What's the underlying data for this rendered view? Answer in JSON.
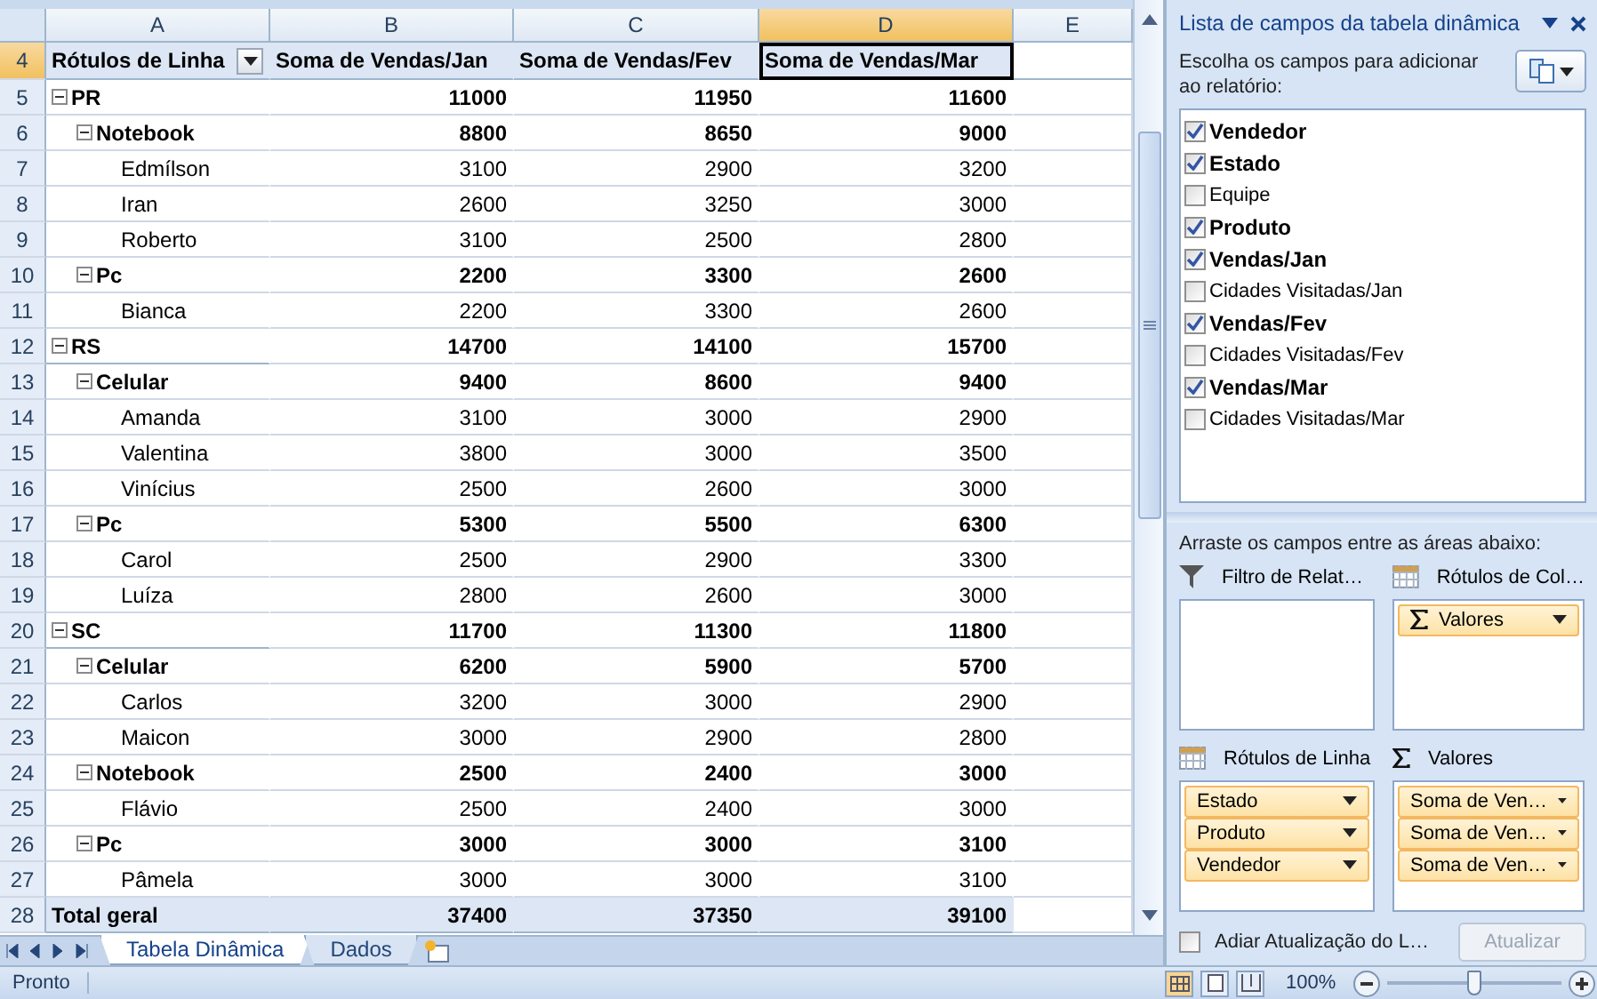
{
  "sheet": {
    "columns": [
      {
        "label": "A",
        "selected": false
      },
      {
        "label": "B",
        "selected": false
      },
      {
        "label": "C",
        "selected": false
      },
      {
        "label": "D",
        "selected": true
      },
      {
        "label": "E",
        "selected": false
      }
    ],
    "header_row": {
      "number": "4",
      "cells": [
        "Rótulos de Linha",
        "Soma de Vendas/Jan",
        "Soma de Vendas/Fev",
        "Soma de Vendas/Mar"
      ]
    },
    "rows": [
      {
        "number": "5",
        "label": "PR",
        "values": [
          "11000",
          "11950",
          "11600"
        ],
        "expanded": true,
        "children": [
          {
            "number": "6",
            "label": "Notebook",
            "values": [
              "8800",
              "8650",
              "9000"
            ],
            "expanded": true,
            "children": [
              {
                "number": "7",
                "label": "Edmílson",
                "values": [
                  "3100",
                  "2900",
                  "3200"
                ]
              },
              {
                "number": "8",
                "label": "Iran",
                "values": [
                  "2600",
                  "3250",
                  "3000"
                ]
              },
              {
                "number": "9",
                "label": "Roberto",
                "values": [
                  "3100",
                  "2500",
                  "2800"
                ]
              }
            ]
          },
          {
            "number": "10",
            "label": "Pc",
            "values": [
              "2200",
              "3300",
              "2600"
            ],
            "expanded": true,
            "children": [
              {
                "number": "11",
                "label": "Bianca",
                "values": [
                  "2200",
                  "3300",
                  "2600"
                ]
              }
            ]
          }
        ]
      },
      {
        "number": "12",
        "label": "RS",
        "values": [
          "14700",
          "14100",
          "15700"
        ],
        "expanded": true,
        "children": [
          {
            "number": "13",
            "label": "Celular",
            "values": [
              "9400",
              "8600",
              "9400"
            ],
            "expanded": true,
            "children": [
              {
                "number": "14",
                "label": "Amanda",
                "values": [
                  "3100",
                  "3000",
                  "2900"
                ]
              },
              {
                "number": "15",
                "label": "Valentina",
                "values": [
                  "3800",
                  "3000",
                  "3500"
                ]
              },
              {
                "number": "16",
                "label": "Vinícius",
                "values": [
                  "2500",
                  "2600",
                  "3000"
                ]
              }
            ]
          },
          {
            "number": "17",
            "label": "Pc",
            "values": [
              "5300",
              "5500",
              "6300"
            ],
            "expanded": true,
            "children": [
              {
                "number": "18",
                "label": "Carol",
                "values": [
                  "2500",
                  "2900",
                  "3300"
                ]
              },
              {
                "number": "19",
                "label": "Luíza",
                "values": [
                  "2800",
                  "2600",
                  "3000"
                ]
              }
            ]
          }
        ]
      },
      {
        "number": "20",
        "label": "SC",
        "values": [
          "11700",
          "11300",
          "11800"
        ],
        "expanded": true,
        "children": [
          {
            "number": "21",
            "label": "Celular",
            "values": [
              "6200",
              "5900",
              "5700"
            ],
            "expanded": true,
            "children": [
              {
                "number": "22",
                "label": "Carlos",
                "values": [
                  "3200",
                  "3000",
                  "2900"
                ]
              },
              {
                "number": "23",
                "label": "Maicon",
                "values": [
                  "3000",
                  "2900",
                  "2800"
                ]
              }
            ]
          },
          {
            "number": "24",
            "label": "Notebook",
            "values": [
              "2500",
              "2400",
              "3000"
            ],
            "expanded": true,
            "children": [
              {
                "number": "25",
                "label": "Flávio",
                "values": [
                  "2500",
                  "2400",
                  "3000"
                ]
              }
            ]
          },
          {
            "number": "26",
            "label": "Pc",
            "values": [
              "3000",
              "3000",
              "3100"
            ],
            "expanded": true,
            "children": [
              {
                "number": "27",
                "label": "Pâmela",
                "values": [
                  "3000",
                  "3000",
                  "3100"
                ]
              }
            ]
          }
        ]
      }
    ],
    "total_row": {
      "number": "28",
      "label": "Total geral",
      "values": [
        "37400",
        "37350",
        "39100"
      ]
    }
  },
  "sheet_tabs": [
    {
      "label": "Tabela Dinâmica",
      "selected": true
    },
    {
      "label": "Dados",
      "selected": false
    }
  ],
  "status_bar": {
    "text": "Pronto",
    "zoom": "100%",
    "zoom_level": {
      "level": 0.5
    }
  },
  "field_list": {
    "title": "Lista de campos da tabela dinâmica",
    "instruction": "Escolha os campos para adicionar ao relatório:",
    "fields": [
      {
        "label": "Vendedor",
        "checked": true
      },
      {
        "label": "Estado",
        "checked": true
      },
      {
        "label": "Equipe",
        "checked": false
      },
      {
        "label": "Produto",
        "checked": true
      },
      {
        "label": "Vendas/Jan",
        "checked": true
      },
      {
        "label": "Cidades Visitadas/Jan",
        "checked": false
      },
      {
        "label": "Vendas/Fev",
        "checked": true
      },
      {
        "label": "Cidades Visitadas/Fev",
        "checked": false
      },
      {
        "label": "Vendas/Mar",
        "checked": true
      },
      {
        "label": "Cidades Visitadas/Mar",
        "checked": false
      }
    ],
    "areas_instruction": "Arraste os campos entre as áreas abaixo:",
    "areas": [
      {
        "kind": "filter",
        "title": "Filtro de Relat…"
      },
      {
        "kind": "columns",
        "title": "Rótulos de Col…",
        "items": [
          {
            "label": "Valores",
            "sigma": true
          }
        ]
      },
      {
        "kind": "rows",
        "title": "Rótulos de Linha",
        "items": [
          {
            "label": "Estado",
            "sigma": false
          },
          {
            "label": "Produto",
            "sigma": false
          },
          {
            "label": "Vendedor",
            "sigma": false
          }
        ]
      },
      {
        "kind": "values",
        "title": "Valores",
        "items": [
          {
            "label": "Soma de Ven…",
            "sigma": false
          },
          {
            "label": "Soma de Ven…",
            "sigma": false
          },
          {
            "label": "Soma de Ven…",
            "sigma": false
          }
        ]
      }
    ],
    "defer": {
      "label": "Adiar Atualização do L…",
      "checked": false
    },
    "update_button": {
      "label": "Atualizar",
      "disabled": true
    }
  }
}
